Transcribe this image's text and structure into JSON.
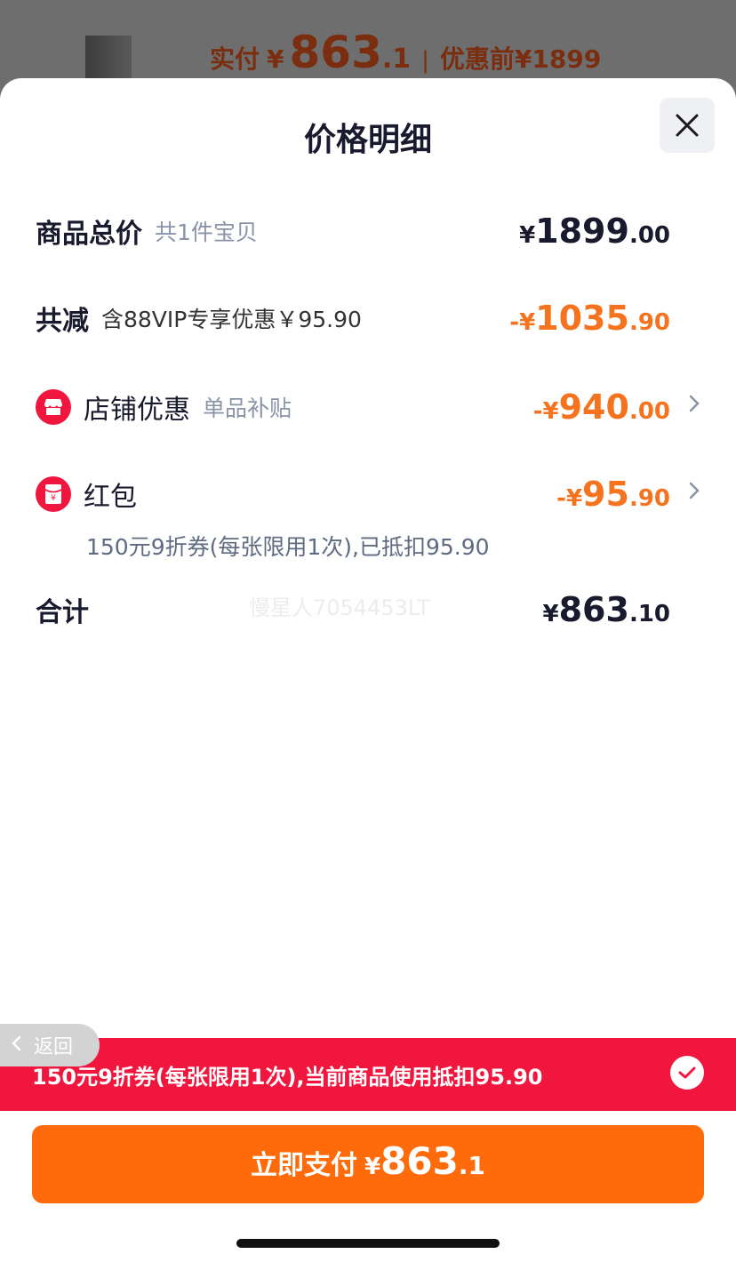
{
  "background": {
    "paid_label": "实付",
    "paid_currency": "¥",
    "paid_int": "863",
    "paid_dec": ".1",
    "separator": "|",
    "before_discount": "优惠前¥1899"
  },
  "sheet": {
    "title": "价格明细",
    "close_icon": "close-icon"
  },
  "rows": {
    "total": {
      "label": "商品总价",
      "sub": "共1件宝贝",
      "sym": "¥",
      "int": "1899",
      "dec": ".00"
    },
    "reduce": {
      "label": "共减",
      "sub": "含88VIP专享优惠￥95.90",
      "sym": "-¥",
      "int": "1035",
      "dec": ".90"
    },
    "shop": {
      "icon": "shop-icon",
      "label": "店铺优惠",
      "sub": "单品补贴",
      "sym": "-¥",
      "int": "940",
      "dec": ".00"
    },
    "redpacket": {
      "icon": "red-packet-icon",
      "label": "红包",
      "sym": "-¥",
      "int": "95",
      "dec": ".90",
      "note": "150元9折券(每张限用1次),已抵扣95.90"
    },
    "sum": {
      "label": "合计",
      "sym": "¥",
      "int": "863",
      "dec": ".10"
    }
  },
  "watermark": "慢星人7054453LT",
  "back": {
    "label": "返回"
  },
  "coupon_banner": {
    "text": "150元9折券(每张限用1次),当前商品使用抵扣95.90",
    "checked": true
  },
  "pay_button": {
    "label": "立即支付",
    "sym": "¥",
    "int": "863",
    "dec": ".1"
  },
  "colors": {
    "accent_orange": "#ff6a0a",
    "discount_orange": "#f5731f",
    "red": "#f0163d"
  }
}
